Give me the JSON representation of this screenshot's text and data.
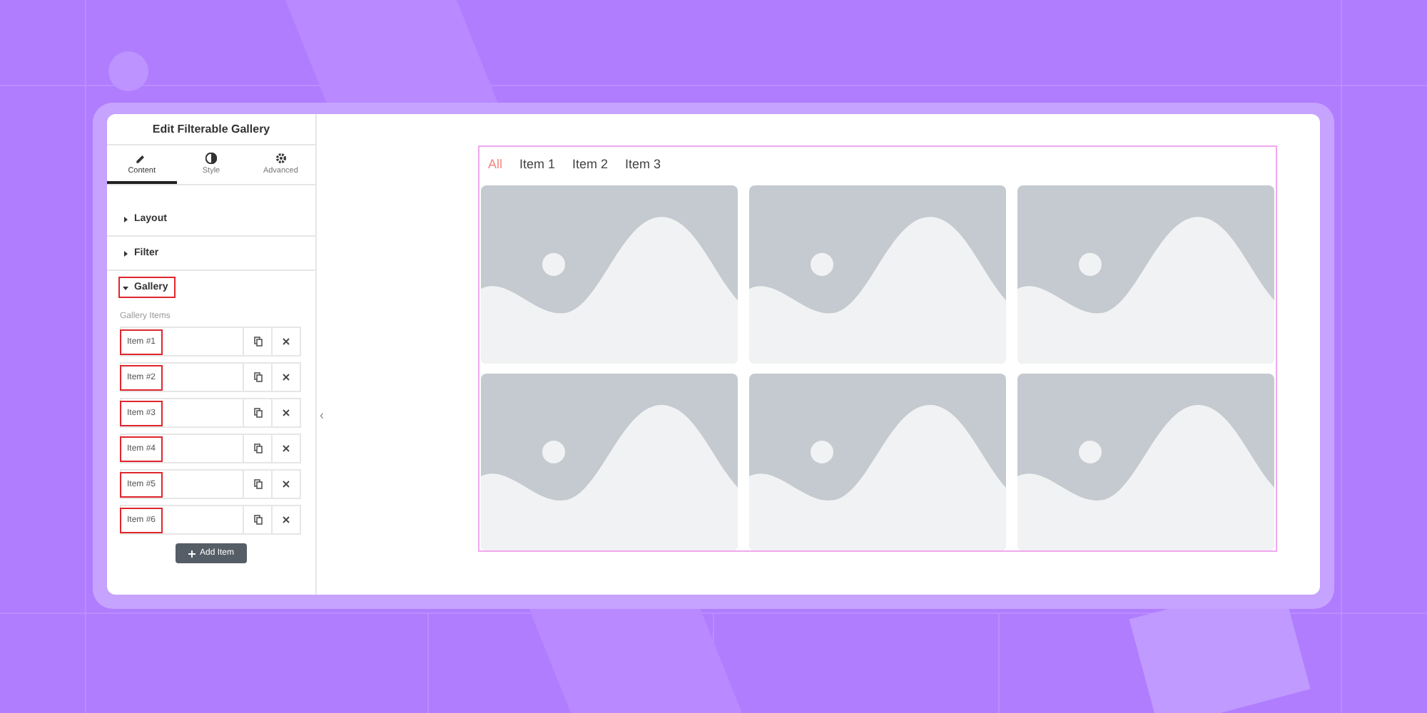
{
  "panel": {
    "title": "Edit Filterable Gallery",
    "tabs": [
      {
        "label": "Content",
        "selected": true
      },
      {
        "label": "Style",
        "selected": false
      },
      {
        "label": "Advanced",
        "selected": false
      }
    ],
    "sections": [
      {
        "label": "Layout",
        "expanded": false,
        "highlighted": false
      },
      {
        "label": "Filter",
        "expanded": false,
        "highlighted": false
      },
      {
        "label": "Gallery",
        "expanded": true,
        "highlighted": true
      }
    ],
    "gallery_items_label": "Gallery Items",
    "gallery_items": [
      {
        "label": "Item #1",
        "highlighted": true
      },
      {
        "label": "Item #2",
        "highlighted": true
      },
      {
        "label": "Item #3",
        "highlighted": true
      },
      {
        "label": "Item #4",
        "highlighted": true
      },
      {
        "label": "Item #5",
        "highlighted": true
      },
      {
        "label": "Item #6",
        "highlighted": true
      }
    ],
    "add_button": "Add Item"
  },
  "collapse_handle": "‹",
  "preview": {
    "filters": [
      {
        "label": "All",
        "selected": true
      },
      {
        "label": "Item 1",
        "selected": false
      },
      {
        "label": "Item 2",
        "selected": false
      },
      {
        "label": "Item 3",
        "selected": false
      }
    ]
  }
}
